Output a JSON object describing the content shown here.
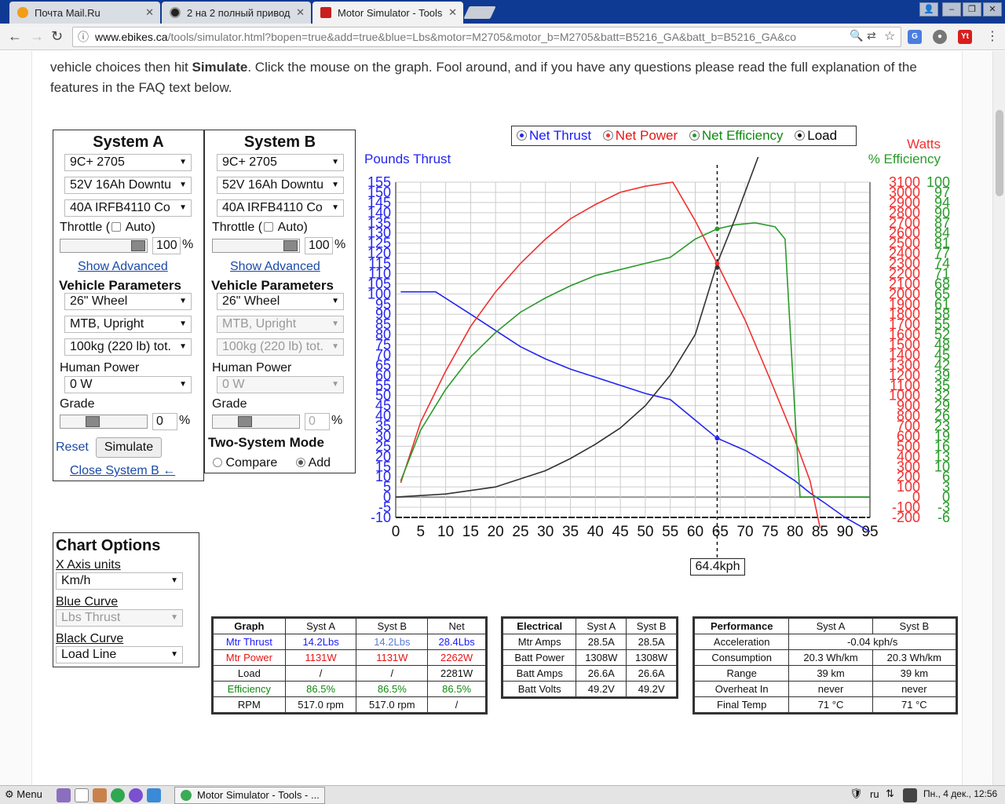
{
  "browser": {
    "tabs": [
      {
        "title": "Почта Mail.Ru",
        "active": false
      },
      {
        "title": "2 на 2 полный привод",
        "active": false
      },
      {
        "title": "Motor Simulator - Tools",
        "active": true
      }
    ],
    "url_host": "www.ebikes.ca",
    "url_path": "/tools/simulator.html?bopen=true&add=true&blue=Lbs&motor=M2705&motor_b=M2705&batt=B5216_GA&batt_b=B5216_GA&co"
  },
  "intro": {
    "text_pre": "vehicle choices then hit ",
    "text_bold": "Simulate",
    "text_post": ". Click the mouse on the graph. Fool around, and if you have any questions please read the full explanation of the features in the FAQ text below."
  },
  "system_a": {
    "title": "System A",
    "motor": "9C+ 2705",
    "battery": "52V 16Ah Downtu",
    "controller": "40A IRFB4110 Co",
    "throttle_label": "Throttle (",
    "auto_label": "Auto)",
    "throttle_value": "100",
    "percent": "%",
    "show_advanced": "Show Advanced",
    "vehicle_params": "Vehicle Parameters",
    "wheel": "26\"  Wheel",
    "frame": "MTB, Upright",
    "mass": "100kg (220 lb) tot.",
    "human_power_label": "Human Power",
    "human_power": "0 W",
    "grade_label": "Grade",
    "grade_value": "0",
    "reset": "Reset",
    "simulate": "Simulate",
    "close_b": "Close System B ←"
  },
  "system_b": {
    "title": "System B",
    "motor": "9C+ 2705",
    "battery": "52V 16Ah Downtu",
    "controller": "40A IRFB4110 Co",
    "throttle_label": "Throttle (",
    "auto_label": "Auto)",
    "throttle_value": "100",
    "percent": "%",
    "show_advanced": "Show Advanced",
    "vehicle_params": "Vehicle Parameters",
    "wheel": "26\"  Wheel",
    "frame": "MTB, Upright",
    "mass": "100kg (220 lb) tot.",
    "human_power_label": "Human Power",
    "human_power": "0 W",
    "grade_label": "Grade",
    "grade_value": "0",
    "two_system_mode": "Two-System Mode",
    "compare": "Compare",
    "add": "Add"
  },
  "legend": {
    "thrust": "Net Thrust",
    "power": "Net Power",
    "efficiency": "Net Efficiency",
    "load": "Load"
  },
  "colors": {
    "thrust": "#2525f0",
    "power": "#f03030",
    "efficiency": "#2a9a2a",
    "load": "#333333"
  },
  "chart_data": {
    "type": "line",
    "y_left_label": "Pounds Thrust",
    "y_right_label_1": "Watts",
    "y_right_label_2": "% Efficiency",
    "x_ticks": [
      0,
      5,
      10,
      15,
      20,
      25,
      30,
      35,
      40,
      45,
      50,
      55,
      60,
      65,
      70,
      75,
      80,
      85,
      90,
      95
    ],
    "xlim": [
      0,
      95
    ],
    "y_left_ticks": [
      -10,
      -5,
      0,
      5,
      10,
      15,
      20,
      25,
      30,
      35,
      40,
      45,
      50,
      55,
      60,
      65,
      70,
      75,
      80,
      85,
      90,
      95,
      100,
      105,
      110,
      115,
      120,
      125,
      130,
      135,
      140,
      145,
      150,
      155
    ],
    "ylim": [
      -10,
      155
    ],
    "y_watts_ticks": [
      "3100",
      "3000",
      "2900",
      "2800",
      "2700",
      "2600",
      "2500",
      "2400",
      "2300",
      "2200",
      "2100",
      "2000",
      "1900",
      "1800",
      "1700",
      "1600",
      "1500",
      "1400",
      "1300",
      "1200",
      "1100",
      "1000",
      "900",
      "800",
      "700",
      "600",
      "500",
      "400",
      "300",
      "200",
      "100",
      "0",
      "-100",
      "-200"
    ],
    "y_eff_ticks": [
      "100",
      "97",
      "94",
      "90",
      "87",
      "84",
      "81",
      "77",
      "74",
      "71",
      "68",
      "65",
      "61",
      "58",
      "55",
      "52",
      "48",
      "45",
      "42",
      "39",
      "35",
      "32",
      "29",
      "26",
      "23",
      "19",
      "16",
      "13",
      "10",
      "6",
      "3",
      "0",
      "-3",
      "-6"
    ],
    "series": [
      {
        "name": "Net Thrust",
        "points": [
          [
            1,
            101
          ],
          [
            8,
            101
          ],
          [
            15,
            90
          ],
          [
            20,
            82
          ],
          [
            25,
            74
          ],
          [
            30,
            68
          ],
          [
            35,
            63
          ],
          [
            40,
            59
          ],
          [
            45,
            55
          ],
          [
            50,
            51
          ],
          [
            55,
            48
          ],
          [
            64.4,
            29
          ],
          [
            70,
            23
          ],
          [
            75,
            16
          ],
          [
            80,
            8
          ],
          [
            83,
            2
          ],
          [
            86,
            -3
          ],
          [
            90,
            -10
          ],
          [
            95,
            -17
          ]
        ]
      },
      {
        "name": "Net Power",
        "points": [
          [
            1,
            7
          ],
          [
            5,
            37
          ],
          [
            10,
            62
          ],
          [
            15,
            84
          ],
          [
            20,
            101
          ],
          [
            25,
            115
          ],
          [
            30,
            127
          ],
          [
            35,
            137
          ],
          [
            40,
            144
          ],
          [
            45,
            150
          ],
          [
            50,
            153
          ],
          [
            55.5,
            155
          ],
          [
            60,
            136
          ],
          [
            64.4,
            115
          ],
          [
            70,
            87
          ],
          [
            75,
            58
          ],
          [
            80,
            28
          ],
          [
            83,
            8
          ],
          [
            85,
            -15
          ]
        ]
      },
      {
        "name": "Net Efficiency",
        "points": [
          [
            1,
            8
          ],
          [
            5,
            33
          ],
          [
            10,
            53
          ],
          [
            15,
            69
          ],
          [
            20,
            81
          ],
          [
            25,
            91
          ],
          [
            30,
            98
          ],
          [
            35,
            104
          ],
          [
            40,
            109
          ],
          [
            45,
            112
          ],
          [
            50,
            115
          ],
          [
            55,
            118
          ],
          [
            60,
            127
          ],
          [
            64.4,
            132
          ],
          [
            68,
            134
          ],
          [
            72,
            135
          ],
          [
            76,
            133
          ],
          [
            78,
            127
          ],
          [
            80,
            40
          ],
          [
            81,
            0
          ],
          [
            95,
            0
          ]
        ]
      },
      {
        "name": "Load",
        "points": [
          [
            0,
            0
          ],
          [
            10,
            1.5
          ],
          [
            20,
            5
          ],
          [
            30,
            13
          ],
          [
            35,
            19
          ],
          [
            40,
            26
          ],
          [
            45,
            34
          ],
          [
            50,
            45
          ],
          [
            55,
            60
          ],
          [
            60,
            80
          ],
          [
            64.4,
            115
          ],
          [
            68,
            137
          ],
          [
            73,
            170
          ]
        ]
      }
    ],
    "cursor_x": 64.4,
    "cursor_label": "64.4kph"
  },
  "chart_options": {
    "title": "Chart Options",
    "x_axis_label": "X Axis units",
    "x_axis_value": "Km/h",
    "blue_label": "Blue Curve",
    "blue_value": "Lbs Thrust",
    "black_label": "Black Curve",
    "black_value": "Load Line"
  },
  "graph_table": {
    "headers": [
      "Graph",
      "Syst A",
      "Syst B",
      "Net"
    ],
    "rows": [
      {
        "label": "Mtr Thrust",
        "a": "14.2Lbs",
        "b": "14.2Lbs",
        "net": "28.4Lbs",
        "color": "blue"
      },
      {
        "label": "Mtr Power",
        "a": "1131W",
        "b": "1131W",
        "net": "2262W",
        "color": "red"
      },
      {
        "label": "Load",
        "a": "/",
        "b": "/",
        "net": "2281W",
        "color": ""
      },
      {
        "label": "Efficiency",
        "a": "86.5%",
        "b": "86.5%",
        "net": "86.5%",
        "color": "green"
      },
      {
        "label": "RPM",
        "a": "517.0 rpm",
        "b": "517.0 rpm",
        "net": "/",
        "color": ""
      }
    ]
  },
  "electrical_table": {
    "headers": [
      "Electrical",
      "Syst A",
      "Syst B"
    ],
    "rows": [
      {
        "label": "Mtr Amps",
        "a": "28.5A",
        "b": "28.5A"
      },
      {
        "label": "Batt Power",
        "a": "1308W",
        "b": "1308W"
      },
      {
        "label": "Batt Amps",
        "a": "26.6A",
        "b": "26.6A"
      },
      {
        "label": "Batt Volts",
        "a": "49.2V",
        "b": "49.2V"
      }
    ]
  },
  "performance_table": {
    "headers": [
      "Performance",
      "Syst A",
      "Syst B"
    ],
    "accel_label": "Acceleration",
    "accel_value": "-0.04 kph/s",
    "rows": [
      {
        "label": "Consumption",
        "a": "20.3 Wh/km",
        "b": "20.3 Wh/km"
      },
      {
        "label": "Range",
        "a": "39 km",
        "b": "39 km"
      },
      {
        "label": "Overheat In",
        "a": "never",
        "b": "never"
      },
      {
        "label": "Final Temp",
        "a": "71 °C",
        "b": "71 °C"
      }
    ]
  },
  "taskbar": {
    "menu": "Menu",
    "window": "Motor Simulator - Tools - ...",
    "lang": "ru",
    "clock": "Пн., 4 дек., 12:56"
  }
}
